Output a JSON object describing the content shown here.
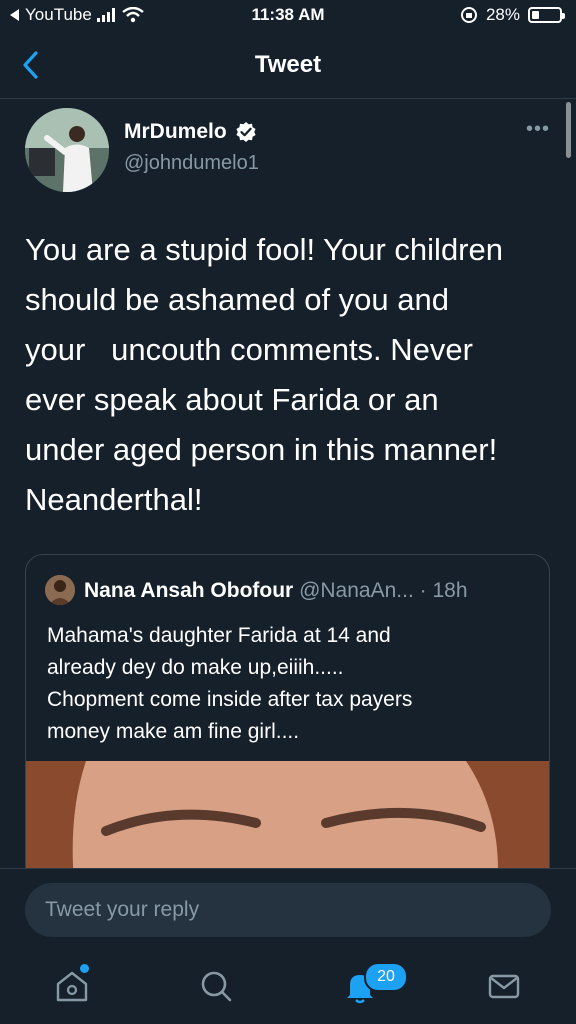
{
  "status_bar": {
    "back_app": "YouTube",
    "time": "11:38 AM",
    "battery": "28%",
    "battery_level": 0.28
  },
  "nav": {
    "title": "Tweet"
  },
  "tweet": {
    "display_name": "MrDumelo",
    "handle": "@johndumelo1",
    "verified": true,
    "more": "•••",
    "text": "You are a stupid fool! Your children\nshould be ashamed of you and\nyour   uncouth comments. Never\never speak about Farida or an\nunder aged person in this manner!\nNeanderthal!"
  },
  "quote": {
    "display_name": "Nana Ansah Obofour",
    "handle": "@NanaAn...",
    "time": "· 18h",
    "text": "Mahama's daughter Farida at 14 and\nalready dey do make up,eiiih.....\nChopment come inside after tax payers\nmoney make am fine girl...."
  },
  "reply": {
    "placeholder": "Tweet your reply"
  },
  "tabs": {
    "notifications_badge": "20"
  },
  "colors": {
    "background": "#15202b",
    "accent": "#1da1f2",
    "secondary_text": "#8899a6"
  }
}
